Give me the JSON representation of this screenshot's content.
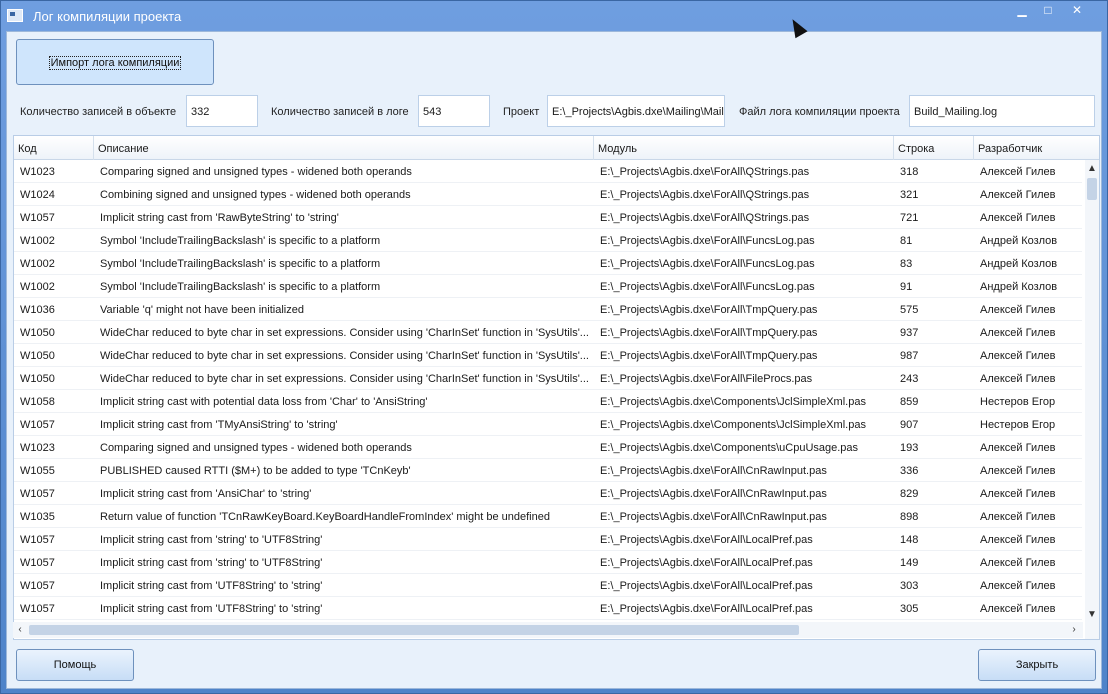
{
  "window": {
    "title": "Лог компиляции проекта",
    "minimize_glyph": "▁",
    "maximize_glyph": "□",
    "close_glyph": "✕"
  },
  "toolbar": {
    "import_label": "Импорт лога компиляции"
  },
  "info": {
    "object_count_label": "Количество записей в объекте",
    "object_count_value": "332",
    "log_count_label": "Количество записей в логе",
    "log_count_value": "543",
    "project_label": "Проект",
    "project_value": "E:\\_Projects\\Agbis.dxe\\Mailing\\Maili",
    "logfile_label": "Файл лога компиляции проекта",
    "logfile_value": "Build_Mailing.log"
  },
  "table": {
    "columns": [
      "Код",
      "Описание",
      "Модуль",
      "Строка",
      "Разработчик"
    ],
    "rows": [
      [
        "W1023",
        "Comparing signed and unsigned types - widened both operands",
        "E:\\_Projects\\Agbis.dxe\\ForAll\\QStrings.pas",
        "318",
        "Алексей Гилев"
      ],
      [
        "W1024",
        "Combining signed and unsigned types - widened both operands",
        "E:\\_Projects\\Agbis.dxe\\ForAll\\QStrings.pas",
        "321",
        "Алексей Гилев"
      ],
      [
        "W1057",
        "Implicit string cast from 'RawByteString' to 'string'",
        "E:\\_Projects\\Agbis.dxe\\ForAll\\QStrings.pas",
        "721",
        "Алексей Гилев"
      ],
      [
        "W1002",
        "Symbol 'IncludeTrailingBackslash' is specific to a platform",
        "E:\\_Projects\\Agbis.dxe\\ForAll\\FuncsLog.pas",
        "81",
        "Андрей Козлов"
      ],
      [
        "W1002",
        "Symbol 'IncludeTrailingBackslash' is specific to a platform",
        "E:\\_Projects\\Agbis.dxe\\ForAll\\FuncsLog.pas",
        "83",
        "Андрей Козлов"
      ],
      [
        "W1002",
        "Symbol 'IncludeTrailingBackslash' is specific to a platform",
        "E:\\_Projects\\Agbis.dxe\\ForAll\\FuncsLog.pas",
        "91",
        "Андрей Козлов"
      ],
      [
        "W1036",
        "Variable 'q' might not have been initialized",
        "E:\\_Projects\\Agbis.dxe\\ForAll\\TmpQuery.pas",
        "575",
        "Алексей Гилев"
      ],
      [
        "W1050",
        "WideChar reduced to byte char in set expressions.  Consider using 'CharInSet' function in 'SysUtils'...",
        "E:\\_Projects\\Agbis.dxe\\ForAll\\TmpQuery.pas",
        "937",
        "Алексей Гилев"
      ],
      [
        "W1050",
        "WideChar reduced to byte char in set expressions.  Consider using 'CharInSet' function in 'SysUtils'...",
        "E:\\_Projects\\Agbis.dxe\\ForAll\\TmpQuery.pas",
        "987",
        "Алексей Гилев"
      ],
      [
        "W1050",
        "WideChar reduced to byte char in set expressions.  Consider using 'CharInSet' function in 'SysUtils'...",
        "E:\\_Projects\\Agbis.dxe\\ForAll\\FileProcs.pas",
        "243",
        "Алексей Гилев"
      ],
      [
        "W1058",
        "Implicit string cast with potential data loss from 'Char' to 'AnsiString'",
        "E:\\_Projects\\Agbis.dxe\\Components\\JclSimpleXml.pas",
        "859",
        "Нестеров Егор"
      ],
      [
        "W1057",
        "Implicit string cast from 'TMyAnsiString' to 'string'",
        "E:\\_Projects\\Agbis.dxe\\Components\\JclSimpleXml.pas",
        "907",
        "Нестеров Егор"
      ],
      [
        "W1023",
        "Comparing signed and unsigned types - widened both operands",
        "E:\\_Projects\\Agbis.dxe\\Components\\uCpuUsage.pas",
        "193",
        "Алексей Гилев"
      ],
      [
        "W1055",
        "PUBLISHED caused RTTI ($M+) to be added to type 'TCnKeyb'",
        "E:\\_Projects\\Agbis.dxe\\ForAll\\CnRawInput.pas",
        "336",
        "Алексей Гилев"
      ],
      [
        "W1057",
        "Implicit string cast from 'AnsiChar' to 'string'",
        "E:\\_Projects\\Agbis.dxe\\ForAll\\CnRawInput.pas",
        "829",
        "Алексей Гилев"
      ],
      [
        "W1035",
        "Return value of function 'TCnRawKeyBoard.KeyBoardHandleFromIndex' might be undefined",
        "E:\\_Projects\\Agbis.dxe\\ForAll\\CnRawInput.pas",
        "898",
        "Алексей Гилев"
      ],
      [
        "W1057",
        "Implicit string cast from 'string' to 'UTF8String'",
        "E:\\_Projects\\Agbis.dxe\\ForAll\\LocalPref.pas",
        "148",
        "Алексей Гилев"
      ],
      [
        "W1057",
        "Implicit string cast from 'string' to 'UTF8String'",
        "E:\\_Projects\\Agbis.dxe\\ForAll\\LocalPref.pas",
        "149",
        "Алексей Гилев"
      ],
      [
        "W1057",
        "Implicit string cast from 'UTF8String' to 'string'",
        "E:\\_Projects\\Agbis.dxe\\ForAll\\LocalPref.pas",
        "303",
        "Алексей Гилев"
      ],
      [
        "W1057",
        "Implicit string cast from 'UTF8String' to 'string'",
        "E:\\_Projects\\Agbis.dxe\\ForAll\\LocalPref.pas",
        "305",
        "Алексей Гилев"
      ]
    ]
  },
  "footer": {
    "help_label": "Помощь",
    "close_label": "Закрыть"
  }
}
